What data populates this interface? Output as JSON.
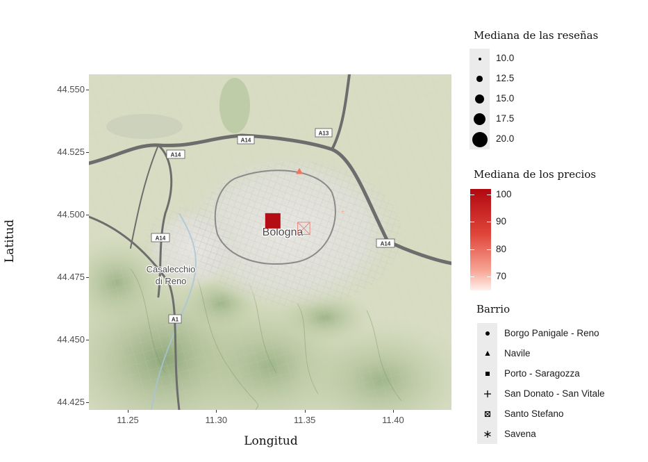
{
  "chart_data": {
    "type": "scatter",
    "xlabel": "Longitud",
    "ylabel": "Latitud",
    "x_ticks": [
      "11.25",
      "11.30",
      "11.35",
      "11.40"
    ],
    "y_ticks": [
      "44.425",
      "44.450",
      "44.475",
      "44.500",
      "44.525",
      "44.550"
    ],
    "xlim": [
      11.228,
      11.433
    ],
    "ylim": [
      44.422,
      44.556
    ],
    "grid": false,
    "legend_placement": "right",
    "map_labels": {
      "bologna": "Bologna",
      "casalecchio_1": "Casalecchio",
      "casalecchio_2": "di Reno",
      "roads": [
        "A14",
        "A14",
        "A14",
        "A13",
        "A14",
        "A1"
      ]
    },
    "points": [
      {
        "barrio": "Porto - Saragozza",
        "lon": 11.332,
        "lat": 44.4975,
        "shape": "square",
        "median_reviews": 20.0,
        "median_price": 100,
        "color": "#b40d13"
      },
      {
        "barrio": "Navile",
        "lon": 11.347,
        "lat": 44.5172,
        "shape": "triangle",
        "median_reviews": 12.5,
        "median_price": 75,
        "color": "#f2745e"
      },
      {
        "barrio": "Santo Stefano",
        "lon": 11.3495,
        "lat": 44.4945,
        "shape": "square-x",
        "median_reviews": 17.5,
        "median_price": 82,
        "color": "#e7847c"
      },
      {
        "barrio": "San Donato - San Vitale",
        "lon": 11.3715,
        "lat": 44.5012,
        "shape": "plus",
        "median_reviews": 10.0,
        "median_price": 68,
        "color": "#f5b09f"
      }
    ],
    "legends": {
      "size": {
        "title": "Mediana de las reseñas",
        "entries": [
          {
            "label": "10.0",
            "value": 10.0
          },
          {
            "label": "12.5",
            "value": 12.5
          },
          {
            "label": "15.0",
            "value": 15.0
          },
          {
            "label": "17.5",
            "value": 17.5
          },
          {
            "label": "20.0",
            "value": 20.0
          }
        ]
      },
      "color": {
        "title": "Mediana de los precios",
        "labels": [
          "100",
          "90",
          "80",
          "70"
        ],
        "values": [
          100,
          90,
          80,
          70
        ],
        "range": [
          65,
          102
        ],
        "low_color": "#fff0ec",
        "high_color": "#b20710"
      },
      "shape": {
        "title": "Barrio",
        "entries": [
          {
            "label": "Borgo Panigale - Reno",
            "shape": "circle"
          },
          {
            "label": "Navile",
            "shape": "triangle"
          },
          {
            "label": "Porto - Saragozza",
            "shape": "square"
          },
          {
            "label": "San Donato - San Vitale",
            "shape": "plus"
          },
          {
            "label": "Santo Stefano",
            "shape": "square-x"
          },
          {
            "label": "Savena",
            "shape": "asterisk"
          }
        ]
      }
    }
  }
}
